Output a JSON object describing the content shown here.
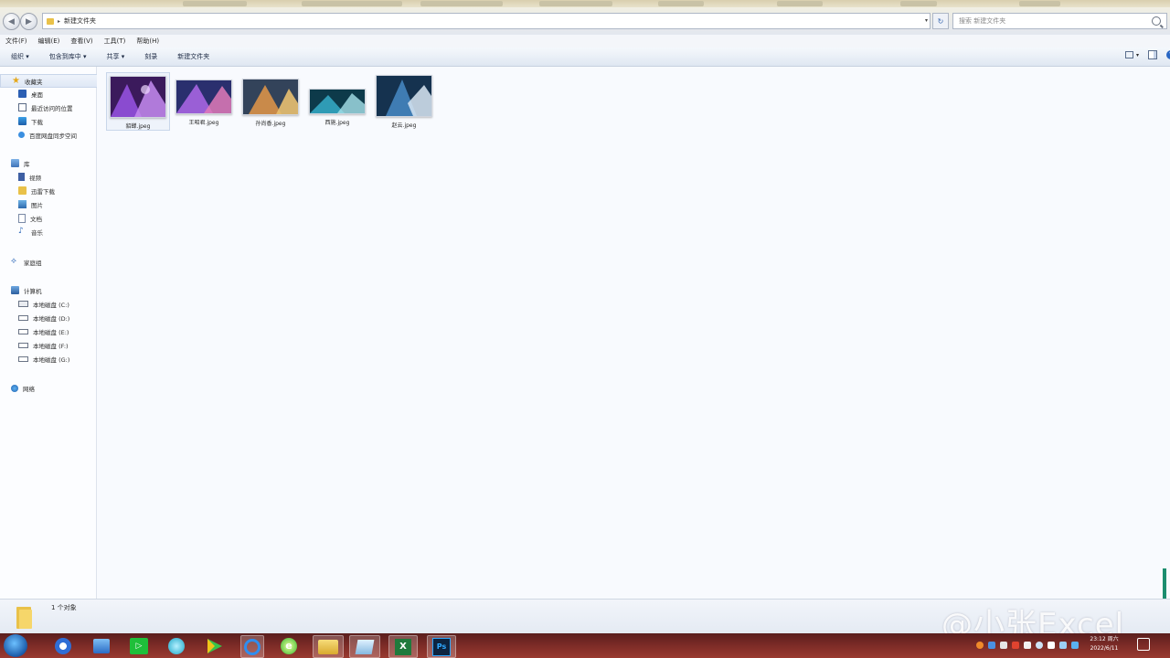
{
  "address_bar": {
    "path": "新建文件夹",
    "search_placeholder": "搜索 新建文件夹"
  },
  "menu": [
    "文件(F)",
    "编辑(E)",
    "查看(V)",
    "工具(T)",
    "帮助(H)"
  ],
  "toolbar": {
    "organize": "组织 ▾",
    "include_in_library": "包含到库中 ▾",
    "share": "共享 ▾",
    "burn": "刻录",
    "new_folder": "新建文件夹"
  },
  "sidebar": {
    "favorites": {
      "label": "收藏夹",
      "items": [
        "桌面",
        "最近访问的位置",
        "下载",
        "百度网盘同步空间"
      ]
    },
    "libraries": {
      "label": "库",
      "items": [
        "视频",
        "迅雷下载",
        "图片",
        "文档",
        "音乐"
      ]
    },
    "homegroup": {
      "label": "家庭组"
    },
    "computer": {
      "label": "计算机",
      "items": [
        "本地磁盘 (C:)",
        "本地磁盘 (D:)",
        "本地磁盘 (E:)",
        "本地磁盘 (F:)",
        "本地磁盘 (G:)"
      ]
    },
    "network": {
      "label": "网络"
    }
  },
  "files": [
    {
      "name": "貂蝉.jpeg",
      "colors": [
        "#3b1a5c",
        "#8a4bd0",
        "#c58cf0"
      ]
    },
    {
      "name": "王昭君.jpeg",
      "colors": [
        "#2a2f6e",
        "#9a5fd6",
        "#e07ab8"
      ]
    },
    {
      "name": "孙尚香.jpeg",
      "colors": [
        "#33435a",
        "#c98a4a",
        "#e8c070"
      ]
    },
    {
      "name": "西施.jpeg",
      "colors": [
        "#0d3a4a",
        "#2f9bb5",
        "#a8e2ea"
      ]
    },
    {
      "name": "赵云.jpeg",
      "colors": [
        "#15324f",
        "#3f7cb3",
        "#d9e8f3"
      ]
    }
  ],
  "status": {
    "count_text": "1 个对象"
  },
  "watermark": "@小张Excel",
  "clock": {
    "time": "23:12 周六",
    "date": "2022/6/11"
  }
}
